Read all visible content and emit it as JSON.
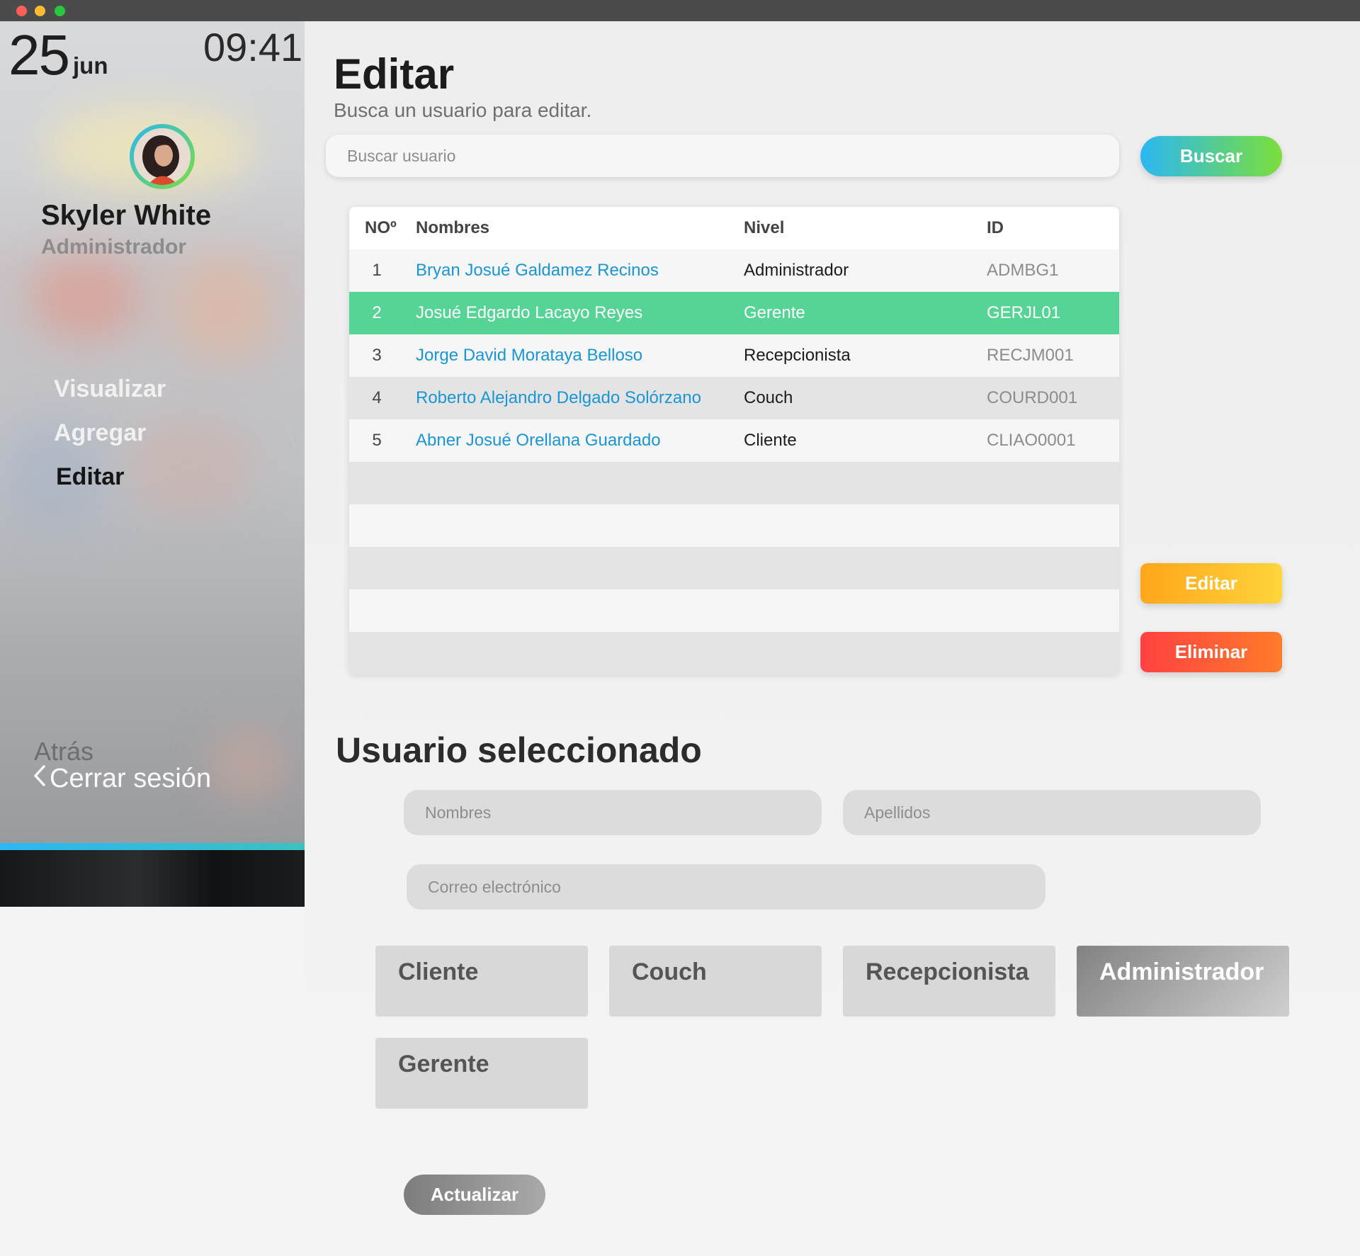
{
  "window": {
    "controls": [
      "close",
      "minimize",
      "zoom"
    ]
  },
  "sidebar": {
    "date_day": "25",
    "date_month": "jun",
    "clock": "09:41",
    "user_name": "Skyler White",
    "user_role": "Administrador",
    "nav": [
      {
        "label": "Visualizar",
        "active": false
      },
      {
        "label": "Agregar",
        "active": false
      },
      {
        "label": "Editar",
        "active": true
      }
    ],
    "back_label": "Atrás",
    "logout_label": "Cerrar sesión"
  },
  "header": {
    "title": "Editar",
    "subtitle": "Busca un usuario para editar.",
    "search_placeholder": "Buscar usuario",
    "search_button": "Buscar"
  },
  "table": {
    "columns": [
      "NOº",
      "Nombres",
      "Nivel",
      "ID"
    ],
    "rows": [
      {
        "no": "1",
        "name": "Bryan Josué Galdamez Recinos",
        "level": "Administrador",
        "id": "ADMBG1",
        "selected": false
      },
      {
        "no": "2",
        "name": "Josué Edgardo Lacayo Reyes",
        "level": "Gerente",
        "id": "GERJL01",
        "selected": true
      },
      {
        "no": "3",
        "name": "Jorge David Morataya Belloso",
        "level": "Recepcionista",
        "id": "RECJM001",
        "selected": false
      },
      {
        "no": "4",
        "name": "Roberto Alejandro Delgado Solórzano",
        "level": "Couch",
        "id": "COURD001",
        "selected": false
      },
      {
        "no": "5",
        "name": "Abner Josué Orellana Guardado",
        "level": "Cliente",
        "id": "CLIAO0001",
        "selected": false
      }
    ],
    "empty_rows": 5
  },
  "actions": {
    "edit_label": "Editar",
    "delete_label": "Eliminar"
  },
  "form": {
    "title": "Usuario seleccionado",
    "nombres_placeholder": "Nombres",
    "apellidos_placeholder": "Apellidos",
    "correo_placeholder": "Correo electrónico",
    "roles": [
      {
        "label": "Cliente",
        "active": false
      },
      {
        "label": "Couch",
        "active": false
      },
      {
        "label": "Recepcionista",
        "active": false
      },
      {
        "label": "Administrador",
        "active": true
      },
      {
        "label": "Gerente",
        "active": false
      }
    ],
    "update_label": "Actualizar"
  },
  "colors": {
    "accent_gradient": [
      "#2bb7f2",
      "#7bdf3a"
    ],
    "selected_row": "#56d495",
    "edit_button": "#ffb020",
    "delete_button": "#ff4a3a",
    "link_text": "#1a96d6"
  },
  "icons": [
    "chevron-left-icon",
    "avatar-photo"
  ]
}
